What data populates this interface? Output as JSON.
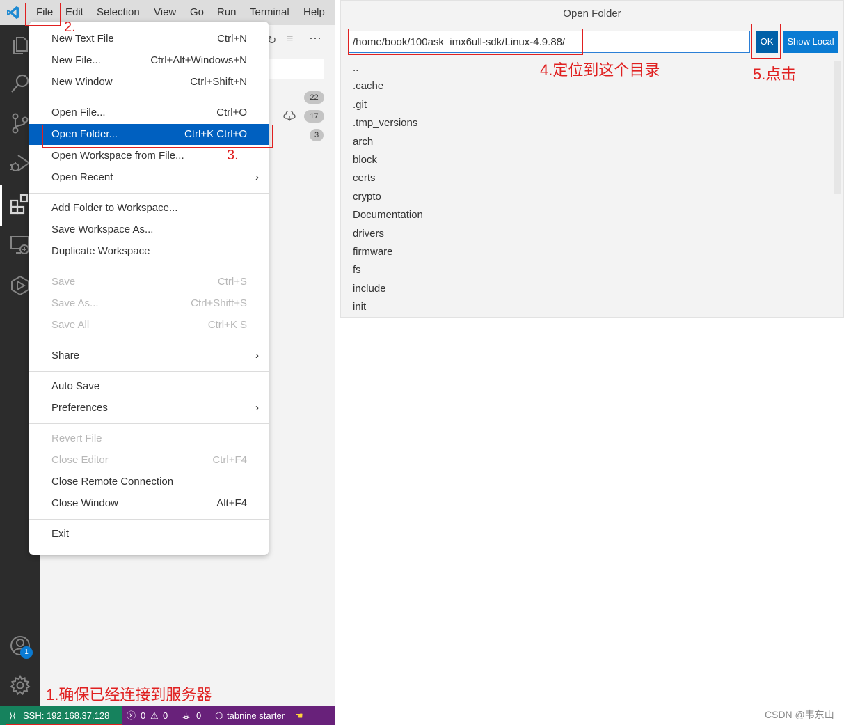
{
  "menubar": {
    "items": [
      "File",
      "Edit",
      "Selection",
      "View",
      "Go",
      "Run",
      "Terminal",
      "Help"
    ]
  },
  "sidebar": {
    "badges": [
      "22",
      "17",
      "3"
    ]
  },
  "file_menu": {
    "groups": [
      [
        {
          "label": "New Text File",
          "shortcut": "Ctrl+N"
        },
        {
          "label": "New File...",
          "shortcut": "Ctrl+Alt+Windows+N"
        },
        {
          "label": "New Window",
          "shortcut": "Ctrl+Shift+N"
        }
      ],
      [
        {
          "label": "Open File...",
          "shortcut": "Ctrl+O"
        },
        {
          "label": "Open Folder...",
          "shortcut": "Ctrl+K Ctrl+O",
          "selected": true
        },
        {
          "label": "Open Workspace from File...",
          "shortcut": ""
        },
        {
          "label": "Open Recent",
          "shortcut": "",
          "submenu": true
        }
      ],
      [
        {
          "label": "Add Folder to Workspace...",
          "shortcut": ""
        },
        {
          "label": "Save Workspace As...",
          "shortcut": ""
        },
        {
          "label": "Duplicate Workspace",
          "shortcut": ""
        }
      ],
      [
        {
          "label": "Save",
          "shortcut": "Ctrl+S",
          "disabled": true
        },
        {
          "label": "Save As...",
          "shortcut": "Ctrl+Shift+S",
          "disabled": true
        },
        {
          "label": "Save All",
          "shortcut": "Ctrl+K S",
          "disabled": true
        }
      ],
      [
        {
          "label": "Share",
          "shortcut": "",
          "submenu": true
        }
      ],
      [
        {
          "label": "Auto Save",
          "shortcut": ""
        },
        {
          "label": "Preferences",
          "shortcut": "",
          "submenu": true
        }
      ],
      [
        {
          "label": "Revert File",
          "shortcut": "",
          "disabled": true
        },
        {
          "label": "Close Editor",
          "shortcut": "Ctrl+F4",
          "disabled": true
        },
        {
          "label": "Close Remote Connection",
          "shortcut": ""
        },
        {
          "label": "Close Window",
          "shortcut": "Alt+F4"
        }
      ],
      [
        {
          "label": "Exit",
          "shortcut": ""
        }
      ]
    ]
  },
  "statusbar": {
    "remote": "SSH: 192.168.37.128",
    "errors": "0",
    "warnings": "0",
    "ports": "0",
    "tabnine": "tabnine starter"
  },
  "accounts_badge": "1",
  "dialog": {
    "title": "Open Folder",
    "path": "/home/book/100ask_imx6ull-sdk/Linux-4.9.88/",
    "ok_label": "OK",
    "show_local_label": "Show Local",
    "folders": [
      "..",
      ".cache",
      ".git",
      ".tmp_versions",
      "arch",
      "block",
      "certs",
      "crypto",
      "Documentation",
      "drivers",
      "firmware",
      "fs",
      "include",
      "init"
    ]
  },
  "annotations": {
    "step1": "1.确保已经连接到服务器",
    "step2": "2.",
    "step3": "3.",
    "step4": "4.定位到这个目录",
    "step5": "5.点击"
  },
  "watermark": "CSDN @韦东山",
  "colors": {
    "activity_bar": "#2c2c2c",
    "menu_selected": "#0060c0",
    "statusbar": "#68217a",
    "remote_indicator": "#16825d",
    "annotation": "#e02020",
    "ok_button": "#0060a8"
  }
}
